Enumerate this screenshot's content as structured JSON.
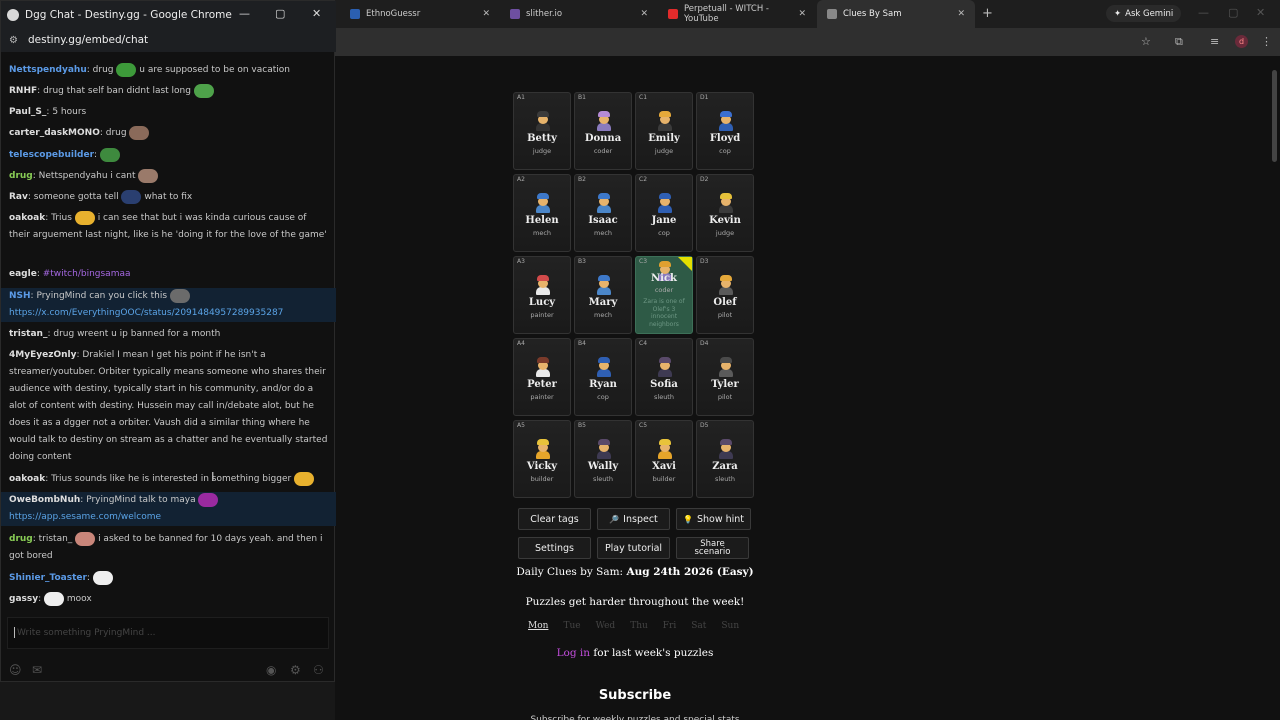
{
  "browser": {
    "tabs": [
      {
        "label": "EthnoGuessr",
        "color": "#2b5fb0"
      },
      {
        "label": "slither.io",
        "color": "#6e4fa1"
      },
      {
        "label": "Perpetuall - WITCH - YouTube",
        "color": "#e12b2b"
      },
      {
        "label": "Clues By Sam",
        "color": "#888888"
      }
    ],
    "gemini_label": "Ask Gemini",
    "avatar_letter": "d"
  },
  "chat": {
    "window_title": "Dgg Chat - Destiny.gg - Google Chrome",
    "url": "destiny.gg/embed/chat",
    "messages": [
      {
        "user": "Nettspendyahu",
        "ucolor": "#5b9ae6",
        "text": "drug",
        "emote": "#3d9a3a",
        "after": "u are supposed to be on vacation"
      },
      {
        "user": "RNHF",
        "ucolor": "#dddddd",
        "text": "drug that self ban didnt last long",
        "emote": "#4ea24a",
        "after": ""
      },
      {
        "user": "Paul_S_",
        "ucolor": "#dddddd",
        "text": "5 hours",
        "emote": "",
        "after": ""
      },
      {
        "user": "carter_daskMONO",
        "ucolor": "#dddddd",
        "text": "drug",
        "emote": "#8a6a5a",
        "after": ""
      },
      {
        "user": "telescopebuilder",
        "ucolor": "#5b9ae6",
        "text": "",
        "emote": "#3e8a3e",
        "after": ""
      },
      {
        "user": "drug",
        "ucolor": "#88cc55",
        "text": "Nettspendyahu i cant",
        "emote": "#9a7a6a",
        "after": ""
      },
      {
        "user": "Rav",
        "ucolor": "#dddddd",
        "text": "someone gotta tell",
        "emote": "#2a3f70",
        "after": "what to fix"
      },
      {
        "user": "oakoak",
        "ucolor": "#dddddd",
        "text": "Trius",
        "emote": "#e8b12e",
        "after": "i can see that but i was kinda curious cause of their arguement last night, like is he 'doing it for the love of the game'"
      },
      {
        "user": "eagle",
        "ucolor": "#dddddd",
        "text": "",
        "tag": "#twitch/bingsamaa",
        "emote": "",
        "after": ""
      },
      {
        "user": "NSH",
        "ucolor": "#5b9ae6",
        "text": "PryingMind can you click this",
        "emote": "#6b6b6b",
        "link": "https://x.com/EverythingOOC/status/2091484957289935287",
        "hl": true
      },
      {
        "user": "tristan_",
        "ucolor": "#dddddd",
        "text": "drug wreent u ip banned for a month",
        "emote": "",
        "after": ""
      },
      {
        "user": "4MyEyezOnly",
        "ucolor": "#dddddd",
        "text": "Drakiel I mean I get his point if he isn't a streamer/youtuber. Orbiter typically means someone who shares their audience with destiny, typically start in his community, and/or do a alot of content with destiny. Hussein may call in/debate alot, but he does it as a dgger not a orbiter. Vaush did a similar thing where he would talk to destiny on stream as a chatter and he eventually started doing content"
      },
      {
        "user": "oakoak",
        "ucolor": "#dddddd",
        "text": "Trius sounds like he is interested in something bigger",
        "emote": "#e8b12e",
        "after": ""
      },
      {
        "user": "OweBombNuh",
        "ucolor": "#dddddd",
        "text": "PryingMind talk to maya",
        "emote": "#9a2aa0",
        "link": "https://app.sesame.com/welcome",
        "hl": true
      },
      {
        "user": "drug",
        "ucolor": "#88cc55",
        "text": "tristan_",
        "emote": "#c9867a",
        "after": "i asked to be banned for 10 days yeah. and then i got bored"
      },
      {
        "user": "Shinier_Toaster",
        "ucolor": "#5b9ae6",
        "text": "",
        "emote": "#eeeeee",
        "after": ""
      },
      {
        "user": "gassy",
        "ucolor": "#dddddd",
        "text": "",
        "emote": "#eeeeee",
        "after": "moox"
      }
    ],
    "input_placeholder": "Write something PryingMind ..."
  },
  "puzzle": {
    "cards": [
      {
        "coord": "A1",
        "name": "Betty",
        "job": "judge",
        "hat": "#3b3b3b",
        "shirt": "#333333"
      },
      {
        "coord": "B1",
        "name": "Donna",
        "job": "coder",
        "hat": "#b58bd6",
        "shirt": "#8a7bbd"
      },
      {
        "coord": "C1",
        "name": "Emily",
        "job": "judge",
        "hat": "#e6a93a",
        "shirt": "#3b3b3b"
      },
      {
        "coord": "D1",
        "name": "Floyd",
        "job": "cop",
        "hat": "#3b6fd1",
        "shirt": "#2f5fb3"
      },
      {
        "coord": "A2",
        "name": "Helen",
        "job": "mech",
        "hat": "#3d78c9",
        "shirt": "#4b86c8"
      },
      {
        "coord": "B2",
        "name": "Isaac",
        "job": "mech",
        "hat": "#3d78c9",
        "shirt": "#4b86c8"
      },
      {
        "coord": "C2",
        "name": "Jane",
        "job": "cop",
        "hat": "#2f5fb3",
        "shirt": "#2f5fb3"
      },
      {
        "coord": "D2",
        "name": "Kevin",
        "job": "judge",
        "hat": "#e6c13a",
        "shirt": "#3b3b3b"
      },
      {
        "coord": "A3",
        "name": "Lucy",
        "job": "painter",
        "hat": "#d24a4a",
        "shirt": "#e8e8e8"
      },
      {
        "coord": "B3",
        "name": "Mary",
        "job": "mech",
        "hat": "#3d78c9",
        "shirt": "#4b86c8"
      },
      {
        "coord": "C3",
        "name": "Nick",
        "job": "coder",
        "hat": "#e0a030",
        "shirt": "#8a7bbd",
        "revealed": true,
        "clue": "Zara is one of Olef's 3 innocent neighbors"
      },
      {
        "coord": "D3",
        "name": "Olef",
        "job": "pilot",
        "hat": "#e6a93a",
        "shirt": "#5a5a5a"
      },
      {
        "coord": "A4",
        "name": "Peter",
        "job": "painter",
        "hat": "#7a3a2a",
        "shirt": "#e8e8e8"
      },
      {
        "coord": "B4",
        "name": "Ryan",
        "job": "cop",
        "hat": "#2f5fb3",
        "shirt": "#2f5fb3"
      },
      {
        "coord": "C4",
        "name": "Sofia",
        "job": "sleuth",
        "hat": "#5a4a6a",
        "shirt": "#3e3a52"
      },
      {
        "coord": "D4",
        "name": "Tyler",
        "job": "pilot",
        "hat": "#4a4a4a",
        "shirt": "#5a5a5a"
      },
      {
        "coord": "A5",
        "name": "Vicky",
        "job": "builder",
        "hat": "#e8c33a",
        "shirt": "#e6a52a"
      },
      {
        "coord": "B5",
        "name": "Wally",
        "job": "sleuth",
        "hat": "#5a4a6a",
        "shirt": "#3e3a52"
      },
      {
        "coord": "C5",
        "name": "Xavi",
        "job": "builder",
        "hat": "#e8c33a",
        "shirt": "#e6a52a"
      },
      {
        "coord": "D5",
        "name": "Zara",
        "job": "sleuth",
        "hat": "#5a4a6a",
        "shirt": "#3e3a52"
      }
    ],
    "buttons": {
      "clear_tags": "Clear tags",
      "inspect": "Inspect",
      "show_hint": "Show hint",
      "settings": "Settings",
      "play_tutorial": "Play tutorial",
      "share_line1": "Share",
      "share_line2": "scenario"
    },
    "daily_prefix": "Daily Clues by Sam:",
    "daily_date": "Aug 24th 2026 (Easy)",
    "harder": "Puzzles get harder throughout the week!",
    "days": [
      "Mon",
      "Tue",
      "Wed",
      "Thu",
      "Fri",
      "Sat",
      "Sun"
    ],
    "login_link": "Log in",
    "login_rest": " for last week's puzzles",
    "subscribe": "Subscribe",
    "subscribe_sub": "Subscribe for weekly puzzles and special stats"
  }
}
